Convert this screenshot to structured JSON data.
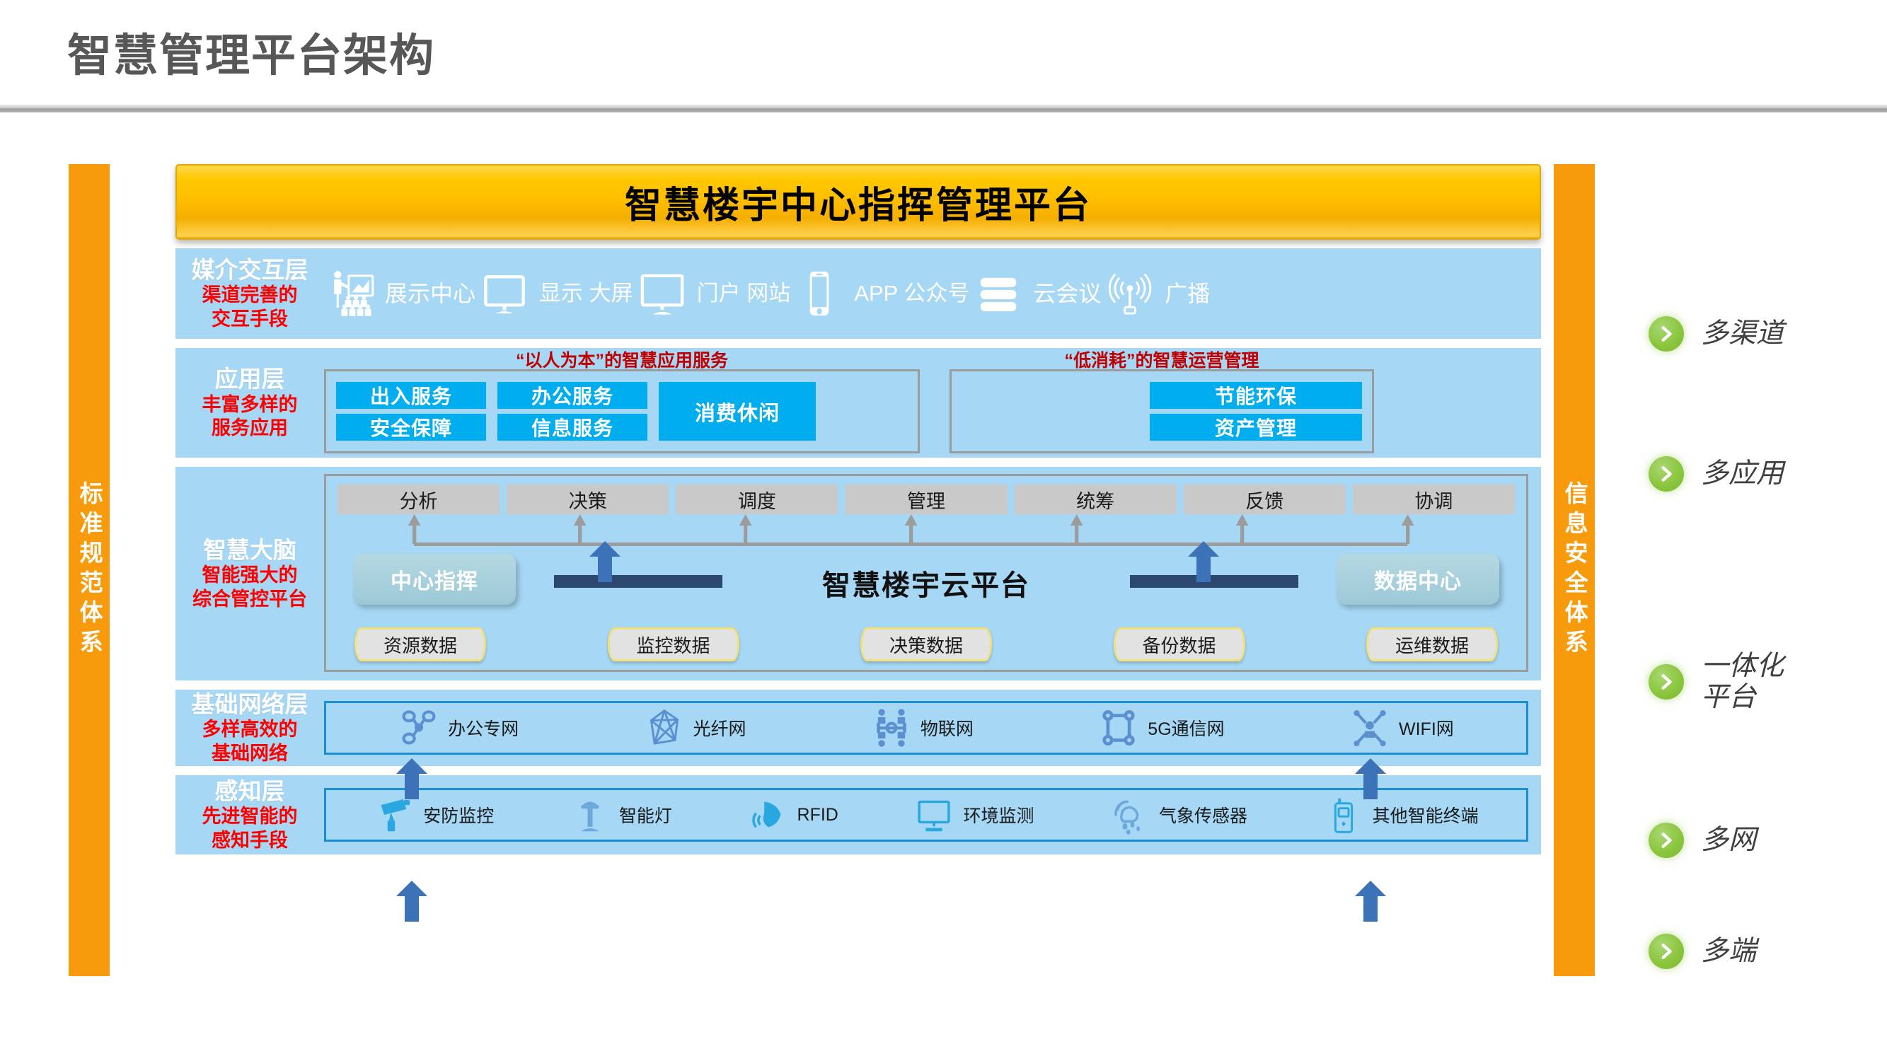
{
  "page": {
    "title": "智慧管理平台架构"
  },
  "banner": {
    "text": "智慧楼宇中心指挥管理平台"
  },
  "side_bars": {
    "left": {
      "text": "标准规范体系"
    },
    "right": {
      "text": "信息安全体系"
    }
  },
  "layers": {
    "media": {
      "label_main": "媒介交互层",
      "label_sub_1": "渠道完善的",
      "label_sub_2": "交互手段",
      "items": [
        {
          "label": "展示中心",
          "icon": "presentation-icon"
        },
        {
          "label": "显示\n大屏",
          "icon": "monitor-icon"
        },
        {
          "label": "门户\n网站",
          "icon": "desktop-icon"
        },
        {
          "label": "APP\n公众号",
          "icon": "phone-icon"
        },
        {
          "label": "云会议",
          "icon": "server-stack-icon"
        },
        {
          "label": "广播",
          "icon": "broadcast-icon"
        }
      ]
    },
    "application": {
      "label_main": "应用层",
      "label_sub_1": "丰富多样的",
      "label_sub_2": "服务应用",
      "group_left": {
        "title": "“以人为本”的智慧应用服务",
        "col1": [
          "出入服务",
          "安全保障"
        ],
        "col2": [
          "办公服务",
          "信息服务"
        ],
        "col3": [
          "消费休闲"
        ]
      },
      "group_right": {
        "title": "“低消耗”的智慧运营管理",
        "items": [
          "节能环保",
          "资产管理"
        ]
      }
    },
    "brain": {
      "label_main": "智慧大脑",
      "label_sub_1": "智能强大的",
      "label_sub_2": "综合管控平台",
      "tags": [
        "分析",
        "决策",
        "调度",
        "管理",
        "统筹",
        "反馈",
        "协调"
      ],
      "pill_left": "中心指挥",
      "pill_right": "数据中心",
      "cloud_name": "智慧楼宇云平台",
      "data_stores": [
        "资源数据",
        "监控数据",
        "决策数据",
        "备份数据",
        "运维数据"
      ]
    },
    "network": {
      "label_main": "基础网络层",
      "label_sub_1": "多样高效的",
      "label_sub_2": "基础网络",
      "items": [
        {
          "label": "办公专网",
          "icon": "network-nodes-icon"
        },
        {
          "label": "光纤网",
          "icon": "fiber-mesh-icon"
        },
        {
          "label": "物联网",
          "icon": "iot-people-icon"
        },
        {
          "label": "5G通信网",
          "icon": "5g-ring-icon"
        },
        {
          "label": "WIFI网",
          "icon": "wifi-person-icon"
        }
      ]
    },
    "sensing": {
      "label_main": "感知层",
      "label_sub_1": "先进智能的",
      "label_sub_2": "感知手段",
      "items": [
        {
          "label": "安防监控",
          "icon": "cctv-camera-icon"
        },
        {
          "label": "智能灯",
          "icon": "smart-lamp-icon"
        },
        {
          "label": "RFID",
          "icon": "rfid-tag-icon"
        },
        {
          "label": "环境监测",
          "icon": "environment-monitor-icon"
        },
        {
          "label": "气象传感器",
          "icon": "weather-sensor-icon"
        },
        {
          "label": "其他智能终端",
          "icon": "handheld-terminal-icon"
        }
      ]
    }
  },
  "callouts": [
    {
      "text": "多渠道"
    },
    {
      "text": "多应用"
    },
    {
      "text": "一体化\n平台"
    },
    {
      "text": "多网"
    },
    {
      "text": "多端"
    }
  ],
  "colors": {
    "orange_bar": "#F79B0C",
    "layer_blue": "#A6D7F4",
    "chip_blue": "#00AEEF",
    "banner_gold": "#FFC800",
    "red_text": "#FF0000",
    "dark_red_title": "#C00000",
    "arrow_blue": "#3B72B8",
    "bullet_green": "#8CC63F",
    "title_gray": "#575757"
  }
}
